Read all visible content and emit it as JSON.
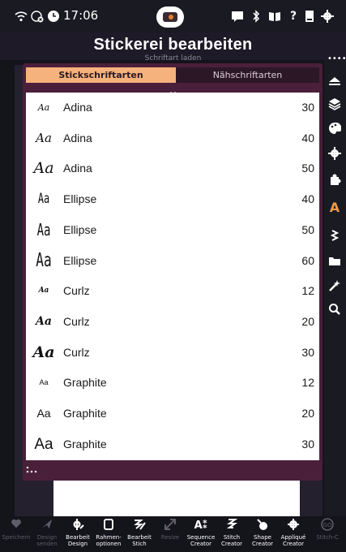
{
  "status_bar": {
    "time": "17:06"
  },
  "header": {
    "title": "Stickerei bearbeiten",
    "subtitle": "Schriftart laden"
  },
  "tabs": [
    {
      "label": "Stickschriftarten",
      "active": true
    },
    {
      "label": "Nähschriftarten",
      "active": false
    }
  ],
  "fonts": [
    {
      "name": "Adina",
      "size": "30",
      "preview": "Aa"
    },
    {
      "name": "Adina",
      "size": "40",
      "preview": "Aa"
    },
    {
      "name": "Adina",
      "size": "50",
      "preview": "Aa"
    },
    {
      "name": "Ellipse",
      "size": "40",
      "preview": "Aa"
    },
    {
      "name": "Ellipse",
      "size": "50",
      "preview": "Aa"
    },
    {
      "name": "Ellipse",
      "size": "60",
      "preview": "Aa"
    },
    {
      "name": "Curlz",
      "size": "12",
      "preview": "Aa"
    },
    {
      "name": "Curlz",
      "size": "20",
      "preview": "Aa"
    },
    {
      "name": "Curlz",
      "size": "30",
      "preview": "Aa"
    },
    {
      "name": "Graphite",
      "size": "12",
      "preview": "Aa"
    },
    {
      "name": "Graphite",
      "size": "20",
      "preview": "Aa"
    },
    {
      "name": "Graphite",
      "size": "30",
      "preview": "Aa"
    }
  ],
  "side_tools": [
    "layers-up-icon",
    "layers-icon",
    "palette-icon",
    "gear-icon",
    "puzzle-icon",
    "text-tool-icon",
    "stitch-icon",
    "folder-icon",
    "wand-icon",
    "search-icon"
  ],
  "toolbar": [
    {
      "label": "Speichern",
      "icon": "heart-icon",
      "enabled": false
    },
    {
      "label": "Design senden",
      "icon": "send-icon",
      "enabled": false
    },
    {
      "label": "Bearbeit Design",
      "icon": "edit-design-icon",
      "enabled": true
    },
    {
      "label": "Rahmen-optionen",
      "icon": "frame-icon",
      "enabled": true
    },
    {
      "label": "Bearbeit Stich",
      "icon": "edit-stitch-icon",
      "enabled": true
    },
    {
      "label": "Resize",
      "icon": "resize-icon",
      "enabled": false
    },
    {
      "label": "Sequence Creator",
      "icon": "sequence-icon",
      "enabled": true
    },
    {
      "label": "Stitch Creator",
      "icon": "stitch-creator-icon",
      "enabled": true
    },
    {
      "label": "Shape Creator",
      "icon": "shape-creator-icon",
      "enabled": true
    },
    {
      "label": "Appliqué Creator",
      "icon": "applique-icon",
      "enabled": true
    },
    {
      "label": "Stitch-C",
      "icon": "go-icon",
      "enabled": false
    }
  ],
  "colors": {
    "dialog": "#4a1f3a",
    "tab_active": "#f6b27c",
    "accent": "#e57e2c"
  }
}
